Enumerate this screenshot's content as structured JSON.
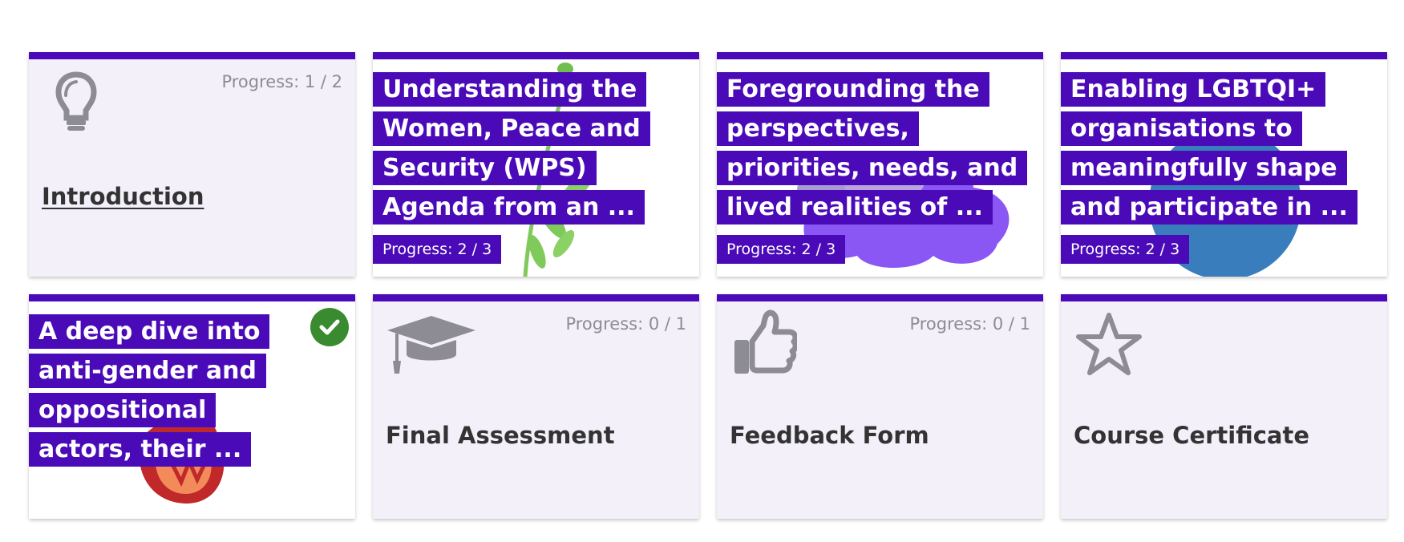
{
  "cards": [
    {
      "title": "Introduction",
      "progress": "Progress: 1 / 2",
      "icon": "lightbulb-icon"
    },
    {
      "title": "Understanding the Women, Peace and Security (WPS) Agenda from an ...",
      "progress": "Progress: 2 / 3",
      "image": "plant-sprig-image"
    },
    {
      "title": "Foregrounding the perspectives, priorities, needs, and lived realities of ...",
      "progress": "Progress: 2 / 3",
      "image": "purple-cloud-image"
    },
    {
      "title": "Enabling LGBTQI+ organisations to meaningfully shape and participate in ...",
      "progress": "Progress: 2 / 3",
      "image": "blue-circle-image"
    },
    {
      "title": "A deep dive into anti-gender and oppositional actors, their ...",
      "image": "flame-image",
      "completed_icon": "checkmark-icon"
    },
    {
      "title": "Final Assessment",
      "progress": "Progress: 0 / 1",
      "icon": "graduation-cap-icon"
    },
    {
      "title": "Feedback Form",
      "progress": "Progress: 0 / 1",
      "icon": "thumbs-up-icon"
    },
    {
      "title": "Course Certificate",
      "icon": "star-outline-icon"
    }
  ],
  "colors": {
    "accent": "#4b0ab8",
    "card_background": "#f3f0fa",
    "icon_gray": "#8d8b93",
    "title_text": "#333333",
    "complete_green": "#3a8b2f"
  }
}
